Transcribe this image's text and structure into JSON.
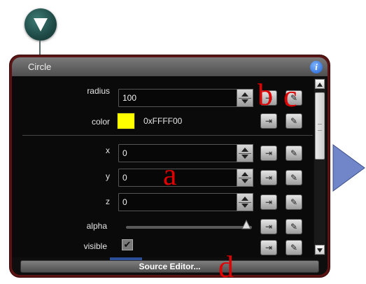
{
  "node": {
    "icon": "triangle-down-icon"
  },
  "panel": {
    "title": "Circle",
    "info_glyph": "i",
    "footer_button": "Source Editor..."
  },
  "props": [
    {
      "label": "radius",
      "value": "100"
    },
    {
      "label": "color",
      "value": "0xFFFF00",
      "swatch": "#ffff00"
    },
    {
      "label": "x",
      "value": "0"
    },
    {
      "label": "y",
      "value": "0"
    },
    {
      "label": "z",
      "value": "0"
    },
    {
      "label": "alpha",
      "value": 1.0
    },
    {
      "label": "visible",
      "checked": true
    }
  ],
  "annotations": {
    "a": "a",
    "b": "b",
    "c": "c",
    "d": "d"
  },
  "colors": {
    "panel_border": "#5a1414",
    "node": "#1f4a46",
    "arrow": "#6a7fc2"
  }
}
